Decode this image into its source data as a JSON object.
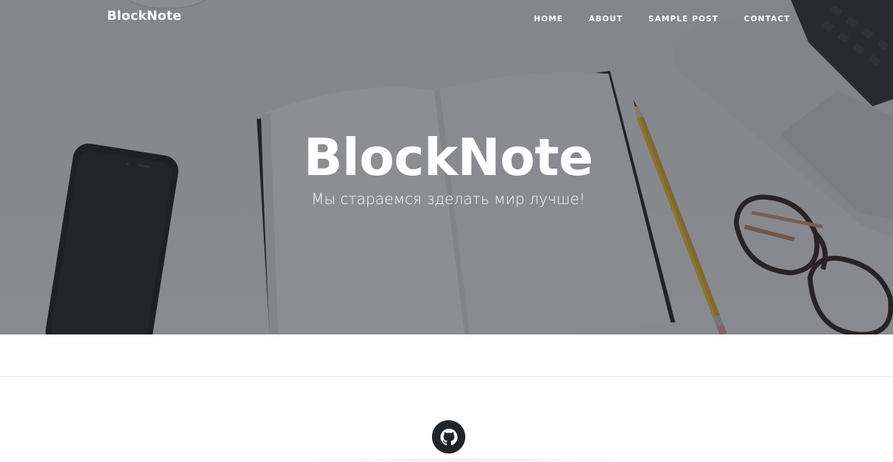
{
  "navbar": {
    "brand": "BlockNote",
    "links": [
      {
        "label": "HOME"
      },
      {
        "label": "ABOUT"
      },
      {
        "label": "SAMPLE POST"
      },
      {
        "label": "CONTACT"
      }
    ]
  },
  "hero": {
    "title": "BlockNote",
    "subtitle": "Мы стараемся зделать мир лучше!"
  },
  "footer": {
    "social_icon": "github-icon"
  },
  "colors": {
    "overlay": "#282a32",
    "footer_icon_bg": "#212529",
    "text_on_hero": "#ffffff"
  }
}
